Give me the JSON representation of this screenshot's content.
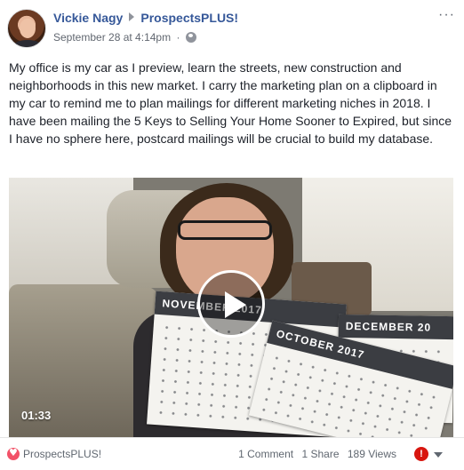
{
  "header": {
    "author": "Vickie Nagy",
    "page": "ProspectsPLUS!",
    "timestamp": "September 28 at 4:14pm",
    "separator": "·",
    "more_label": "···"
  },
  "post": {
    "text": "My office is my car as I preview, learn the streets, new construction and neighborhoods in this new market. I carry the marketing plan on a clipboard in my car to remind me to plan mailings for different marketing niches in 2018. I have been mailing the 5 Keys to Selling Your Home Sooner to Expired, but since I have no sphere here, postcard mailings will be crucial to build my database."
  },
  "video": {
    "duration": "01:33",
    "calendars": [
      "NOVEMBER 2017",
      "DECEMBER 20",
      "OCTOBER 2017"
    ]
  },
  "footer": {
    "page_link": "ProspectsPLUS!",
    "comments": "1 Comment",
    "shares": "1 Share",
    "views": "189 Views",
    "alert_icon": "!"
  },
  "colors": {
    "link": "#365899",
    "meta": "#616770",
    "alert": "#d8160f",
    "heart": "#f25268"
  }
}
